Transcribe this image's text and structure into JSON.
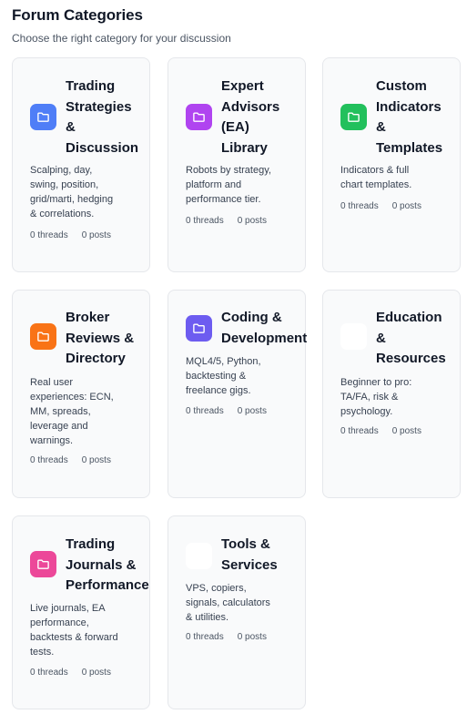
{
  "header": {
    "title": "Forum Categories",
    "subtitle": "Choose the right category for your discussion"
  },
  "categories": [
    {
      "title_lines": [
        "Trading",
        "Strategies",
        "&",
        "Discussion"
      ],
      "description_lines": [
        "Scalping, day,",
        "swing, position,",
        "grid/marti, hedging",
        "& correlations."
      ],
      "threads": "0 threads",
      "posts": "0 posts",
      "icon": "folder-icon",
      "icon_color": "#4f7ef7"
    },
    {
      "title_lines": [
        "Expert",
        "Advisors",
        "(EA)",
        "Library"
      ],
      "description_lines": [
        "Robots by strategy,",
        "platform and",
        "performance tier."
      ],
      "threads": "0 threads",
      "posts": "0 posts",
      "icon": "folder-icon",
      "icon_color": "#b044f0"
    },
    {
      "title_lines": [
        "Custom",
        "Indicators",
        "&",
        "Templates"
      ],
      "description_lines": [
        "Indicators & full",
        "chart templates."
      ],
      "threads": "0 threads",
      "posts": "0 posts",
      "icon": "folder-icon",
      "icon_color": "#22c05c"
    },
    {
      "title_lines": [
        "Broker",
        "Reviews &",
        "Directory"
      ],
      "description_lines": [
        "Real user",
        "experiences: ECN,",
        "MM, spreads,",
        "leverage and",
        "warnings."
      ],
      "threads": "0 threads",
      "posts": "0 posts",
      "icon": "folder-icon",
      "icon_color": "#f97316"
    },
    {
      "title_lines": [
        "Coding &",
        "Development"
      ],
      "description_lines": [
        "MQL4/5, Python,",
        "backtesting &",
        "freelance gigs."
      ],
      "threads": "0 threads",
      "posts": "0 posts",
      "icon": "folder-icon",
      "icon_color": "#6d5cf0"
    },
    {
      "title_lines": [
        "Education",
        "&",
        "Resources"
      ],
      "description_lines": [
        "Beginner to pro:",
        "TA/FA, risk &",
        "psychology."
      ],
      "threads": "0 threads",
      "posts": "0 posts",
      "icon": "folder-icon",
      "icon_color": "#ffffff"
    },
    {
      "title_lines": [
        "Trading",
        "Journals &",
        "Performance"
      ],
      "description_lines": [
        "Live journals, EA",
        "performance,",
        "backtests & forward",
        "tests."
      ],
      "threads": "0 threads",
      "posts": "0 posts",
      "icon": "folder-icon",
      "icon_color": "#ec4899"
    },
    {
      "title_lines": [
        "Tools &",
        "Services"
      ],
      "description_lines": [
        "VPS, copiers,",
        "signals, calculators",
        "& utilities."
      ],
      "threads": "0 threads",
      "posts": "0 posts",
      "icon": "folder-icon",
      "icon_color": "#ffffff"
    }
  ]
}
